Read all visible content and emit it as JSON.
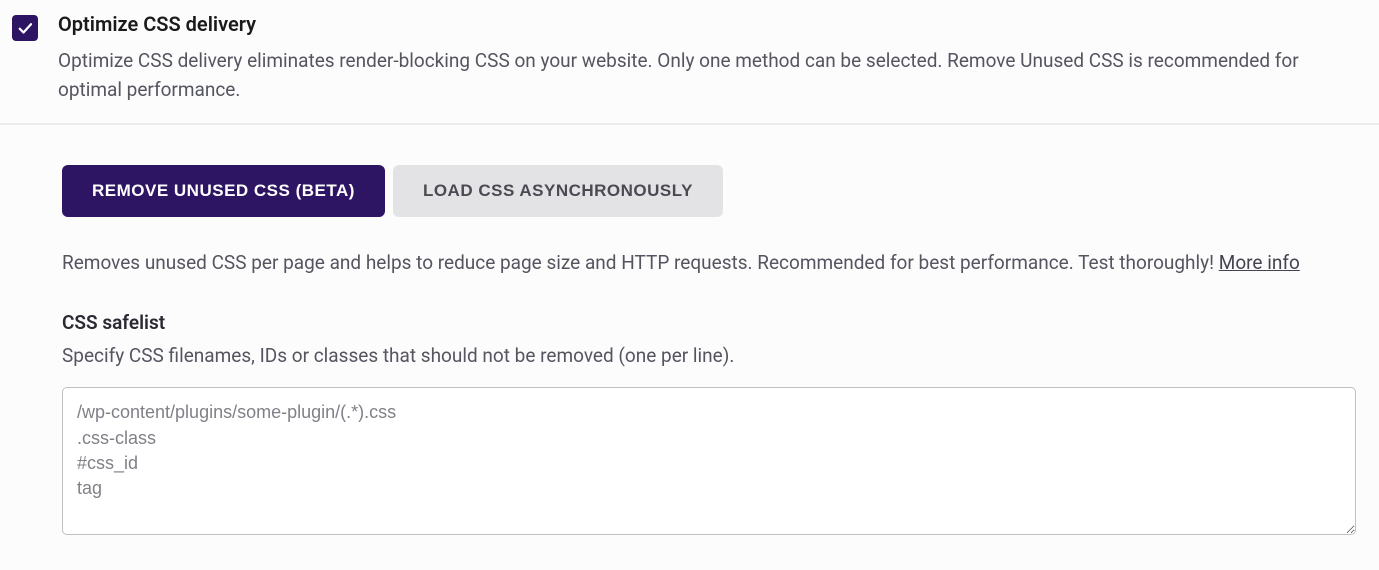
{
  "setting": {
    "title": "Optimize CSS delivery",
    "description": "Optimize CSS delivery eliminates render-blocking CSS on your website. Only one method can be selected. Remove Unused CSS is recommended for optimal performance."
  },
  "tabs": {
    "remove_unused": "REMOVE UNUSED CSS (BETA)",
    "load_async": "LOAD CSS ASYNCHRONOUSLY"
  },
  "tab_description": {
    "text": "Removes unused CSS per page and helps to reduce page size and HTTP requests. Recommended for best performance. Test thoroughly! ",
    "link": "More info"
  },
  "safelist": {
    "title": "CSS safelist",
    "description": "Specify CSS filenames, IDs or classes that should not be removed (one per line).",
    "placeholder": "/wp-content/plugins/some-plugin/(.*).css\n.css-class\n#css_id\ntag"
  }
}
